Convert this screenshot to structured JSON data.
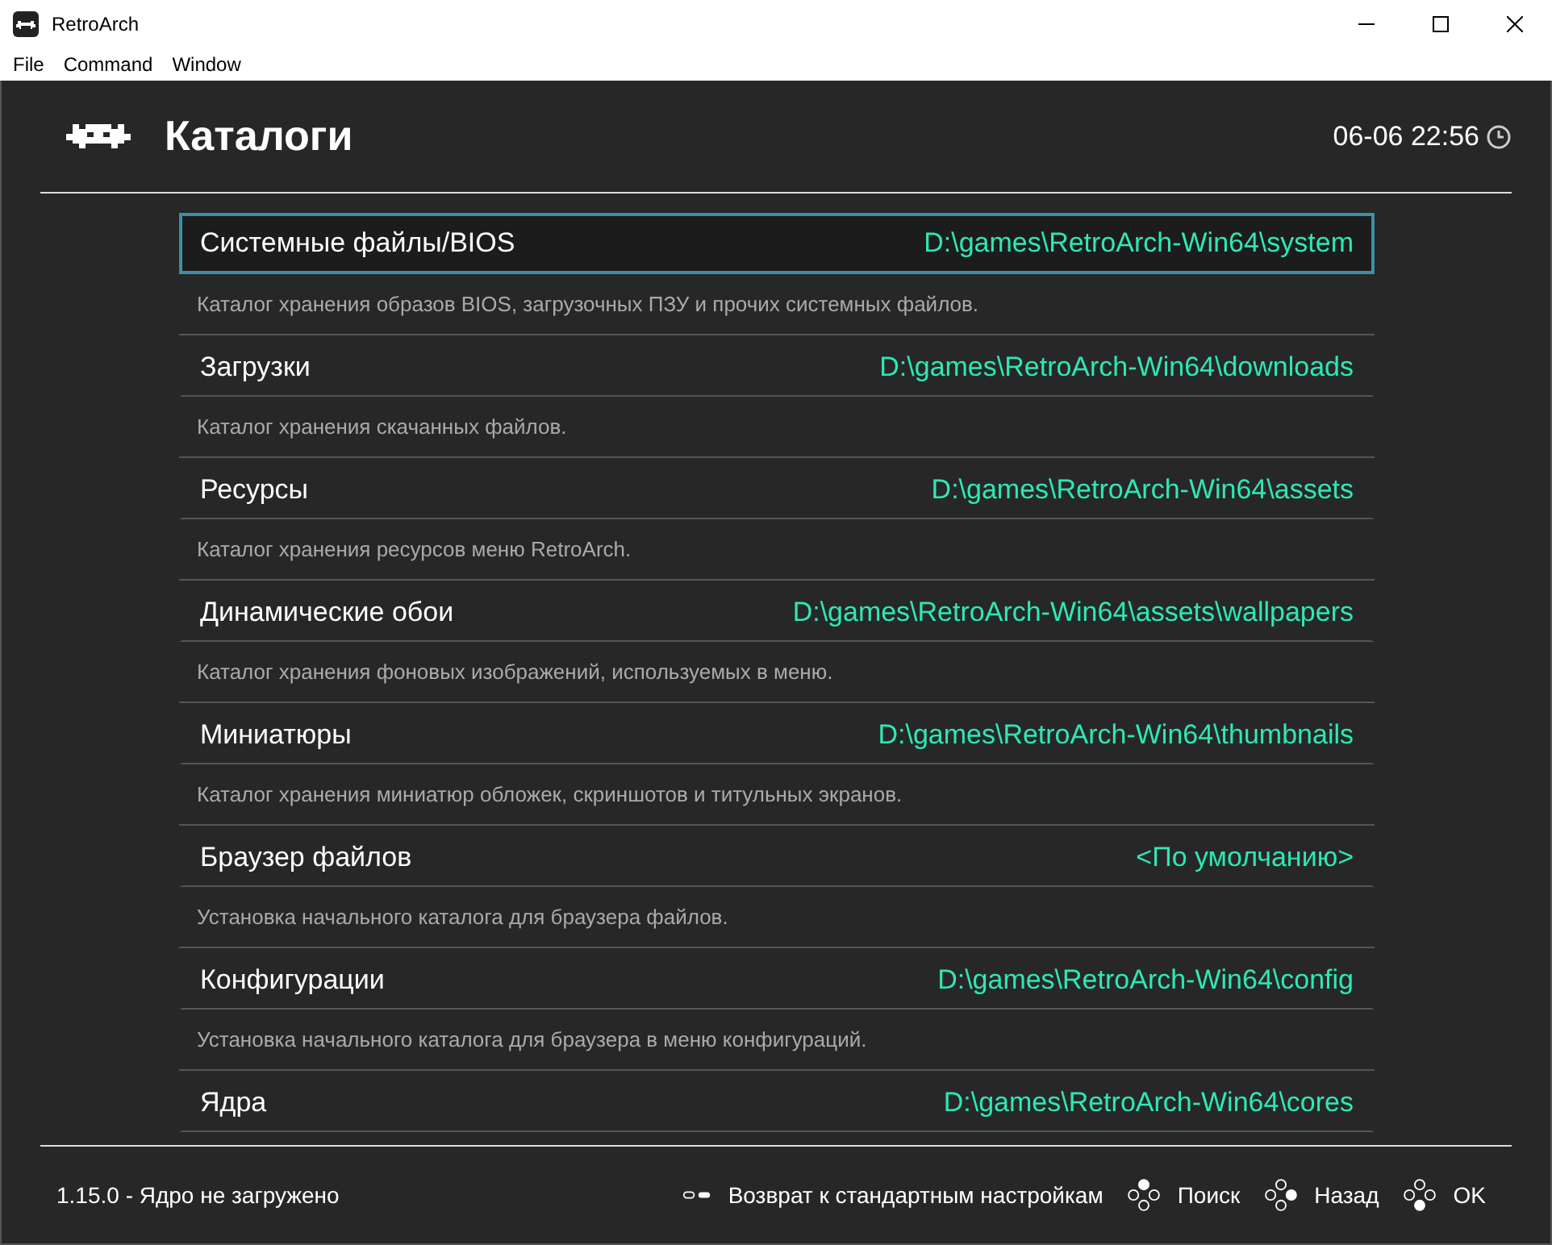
{
  "window": {
    "title": "RetroArch"
  },
  "menu": [
    "File",
    "Command",
    "Window"
  ],
  "header": {
    "title": "Каталоги",
    "clock": "06-06 22:56"
  },
  "items": [
    {
      "label": "Системные файлы/BIOS",
      "value": "D:\\games\\RetroArch-Win64\\system",
      "description": "Каталог хранения образов BIOS, загрузочных ПЗУ и прочих системных файлов.",
      "selected": true
    },
    {
      "label": "Загрузки",
      "value": "D:\\games\\RetroArch-Win64\\downloads",
      "description": "Каталог хранения скачанных файлов.",
      "selected": false
    },
    {
      "label": "Ресурсы",
      "value": "D:\\games\\RetroArch-Win64\\assets",
      "description": "Каталог хранения ресурсов меню RetroArch.",
      "selected": false
    },
    {
      "label": "Динамические обои",
      "value": "D:\\games\\RetroArch-Win64\\assets\\wallpapers",
      "description": "Каталог хранения фоновых изображений, используемых в меню.",
      "selected": false
    },
    {
      "label": "Миниатюры",
      "value": "D:\\games\\RetroArch-Win64\\thumbnails",
      "description": "Каталог хранения миниатюр обложек, скриншотов и титульных экранов.",
      "selected": false
    },
    {
      "label": "Браузер файлов",
      "value": "<По умолчанию>",
      "description": "Установка начального каталога для браузера файлов.",
      "selected": false
    },
    {
      "label": "Конфигурации",
      "value": "D:\\games\\RetroArch-Win64\\config",
      "description": "Установка начального каталога для браузера в меню конфигураций.",
      "selected": false
    },
    {
      "label": "Ядра",
      "value": "D:\\games\\RetroArch-Win64\\cores",
      "selected": false
    }
  ],
  "footer": {
    "status": "1.15.0 - Ядро не загружено",
    "actions": [
      {
        "kind": "select",
        "label": "Возврат к стандартным настройкам"
      },
      {
        "kind": "top",
        "label": "Поиск"
      },
      {
        "kind": "right",
        "label": "Назад"
      },
      {
        "kind": "bottom",
        "label": "OK"
      }
    ]
  }
}
